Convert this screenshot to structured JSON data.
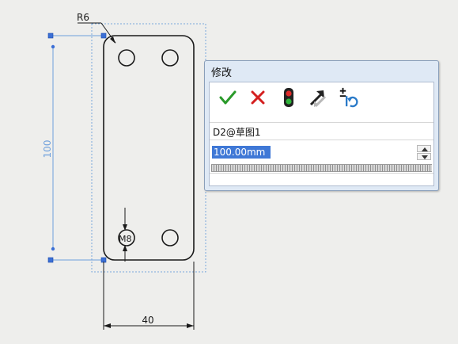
{
  "sketch": {
    "radius_label": "R6",
    "vertical_dim_label": "100",
    "hole_dim_label": "M8",
    "horizontal_dim_label": "40"
  },
  "dialog": {
    "title": "修改",
    "dimension_name": "D2@草图1",
    "value": "100.00mm",
    "tools": [
      {
        "name": "confirm",
        "icon": "checkmark-icon",
        "color": "#2a9a2a"
      },
      {
        "name": "cancel",
        "icon": "close-icon",
        "color": "#d42020"
      },
      {
        "name": "rebuild",
        "icon": "traffic-light-icon",
        "color": "#cc2020"
      },
      {
        "name": "reverse-direction",
        "icon": "reverse-arrow-icon",
        "color": "#222222"
      },
      {
        "name": "reset-increment",
        "icon": "plusminus-reset-icon",
        "color": "#2a7ac8"
      }
    ]
  },
  "colors": {
    "background": "#eeeeec",
    "sketch_line": "#1a1a1a",
    "dimension_blue": "#6fa0dc",
    "selection_dash": "#7aa8dc",
    "handle": "#3b6fd6",
    "value_highlight": "#3f78d6"
  }
}
